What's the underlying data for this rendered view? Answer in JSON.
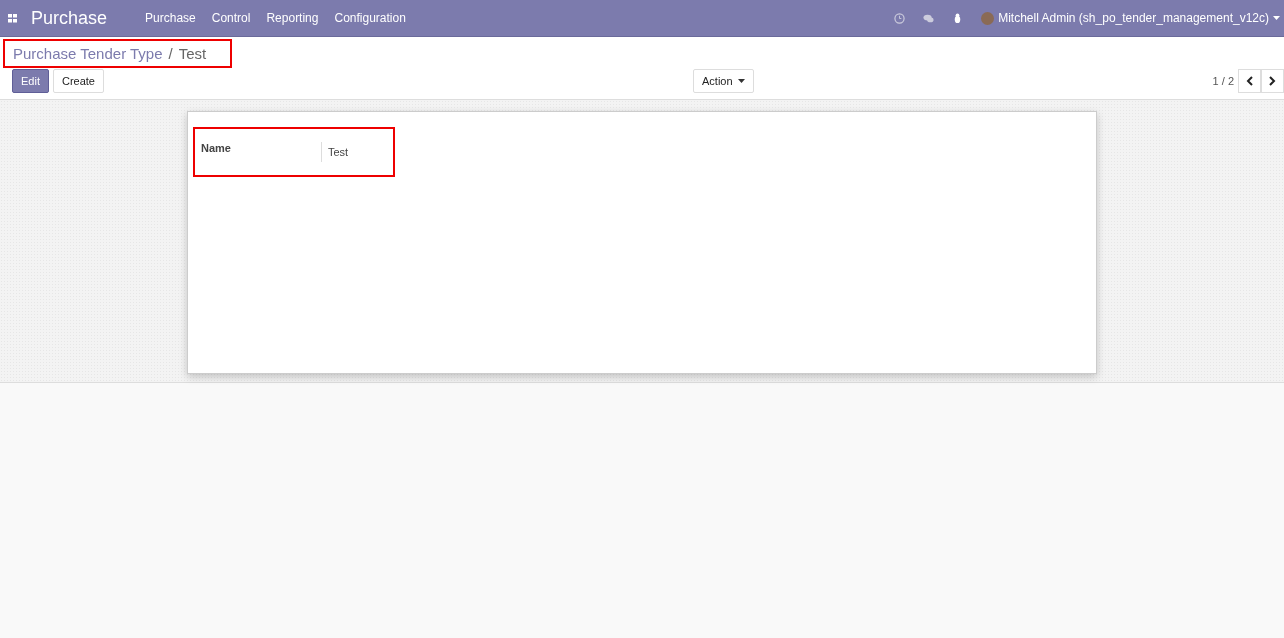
{
  "navbar": {
    "app_title": "Purchase",
    "menu": [
      "Purchase",
      "Control",
      "Reporting",
      "Configuration"
    ],
    "user": "Mitchell Admin (sh_po_tender_management_v12c)"
  },
  "breadcrumb": {
    "parent": "Purchase Tender Type",
    "separator": "/",
    "current": "Test"
  },
  "buttons": [
    {
      "label": "Edit",
      "kind": "primary"
    },
    {
      "label": "Create",
      "kind": "secondary"
    }
  ],
  "action": {
    "label": "Action"
  },
  "pager": {
    "value": "1 / 2"
  },
  "form": {
    "fields": [
      {
        "label": "Name",
        "value": "Test"
      }
    ]
  }
}
